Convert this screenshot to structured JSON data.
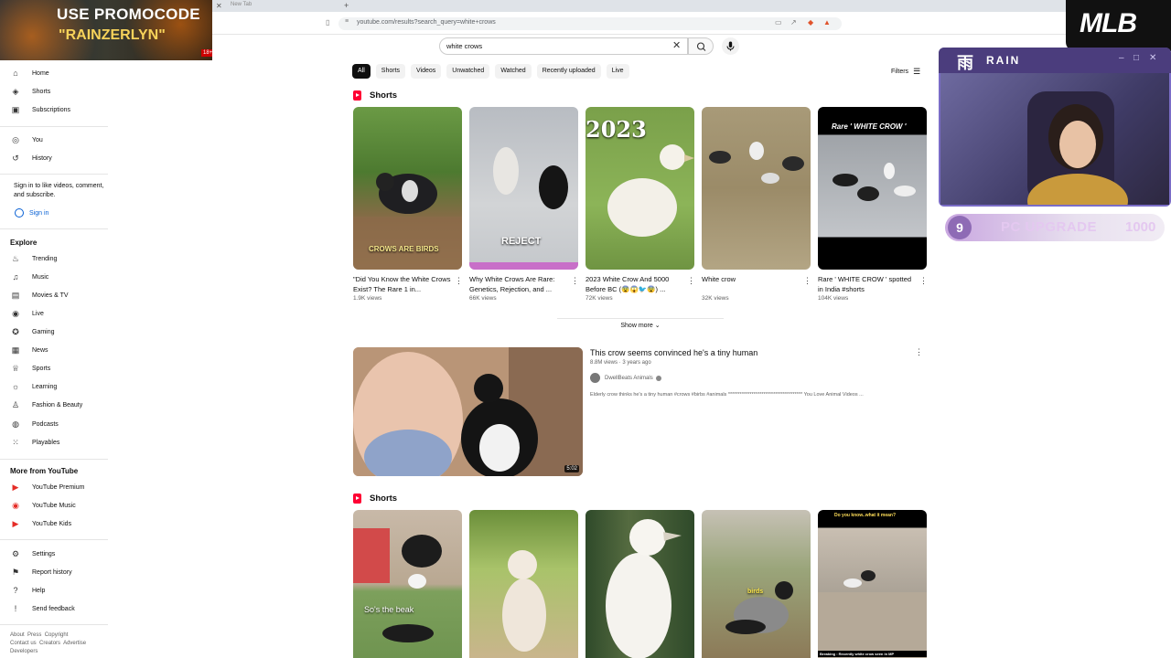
{
  "browser": {
    "tab_label": "New Tab",
    "url": "youtube.com/results?search_query=white+crows"
  },
  "promo": {
    "line1": "USE PROMOCODE",
    "line2": "\"RAINZERLYN\"",
    "age_badge": "18+"
  },
  "search": {
    "value": "white crows"
  },
  "sidebar": {
    "main": [
      {
        "label": "Home",
        "icon": "home-icon"
      },
      {
        "label": "Shorts",
        "icon": "shorts-icon"
      },
      {
        "label": "Subscriptions",
        "icon": "subscriptions-icon"
      }
    ],
    "you": [
      {
        "label": "You",
        "icon": "you-icon"
      },
      {
        "label": "History",
        "icon": "history-icon"
      }
    ],
    "signin_note": "Sign in to like videos, comment, and subscribe.",
    "signin_label": "Sign in",
    "explore_heading": "Explore",
    "explore": [
      {
        "label": "Trending",
        "icon": "trending-icon"
      },
      {
        "label": "Music",
        "icon": "music-icon"
      },
      {
        "label": "Movies & TV",
        "icon": "movies-icon"
      },
      {
        "label": "Live",
        "icon": "live-icon"
      },
      {
        "label": "Gaming",
        "icon": "gaming-icon"
      },
      {
        "label": "News",
        "icon": "news-icon"
      },
      {
        "label": "Sports",
        "icon": "sports-icon"
      },
      {
        "label": "Learning",
        "icon": "learning-icon"
      },
      {
        "label": "Fashion & Beauty",
        "icon": "fashion-icon"
      },
      {
        "label": "Podcasts",
        "icon": "podcasts-icon"
      },
      {
        "label": "Playables",
        "icon": "playables-icon"
      }
    ],
    "more_heading": "More from YouTube",
    "more": [
      {
        "label": "YouTube Premium",
        "icon": "youtube-premium-icon"
      },
      {
        "label": "YouTube Music",
        "icon": "youtube-music-icon"
      },
      {
        "label": "YouTube Kids",
        "icon": "youtube-kids-icon"
      }
    ],
    "settings": [
      {
        "label": "Settings",
        "icon": "settings-icon"
      },
      {
        "label": "Report history",
        "icon": "flag-icon"
      },
      {
        "label": "Help",
        "icon": "help-icon"
      },
      {
        "label": "Send feedback",
        "icon": "feedback-icon"
      }
    ],
    "footer_links": [
      "About",
      "Press",
      "Copyright",
      "Contact us",
      "Creators",
      "Advertise",
      "Developers"
    ]
  },
  "chips": [
    "All",
    "Shorts",
    "Videos",
    "Unwatched",
    "Watched",
    "Recently uploaded",
    "Live"
  ],
  "filters_label": "Filters",
  "shorts_section_1": {
    "title": "Shorts",
    "items": [
      {
        "title": "\"Did You Know the White Crows Exist? The Rare 1 in...",
        "views": "1.9K views",
        "overlay": "CROWS ARE BIRDS"
      },
      {
        "title": "Why White Crows Are Rare: Genetics, Rejection, and ...",
        "views": "66K views",
        "overlay": "REJECT"
      },
      {
        "title": "2023 White Crow And 5000 Before BC (😨😱🐦😨) ...",
        "views": "72K views",
        "overlay": "2023"
      },
      {
        "title": "White crow",
        "views": "32K views",
        "overlay": ""
      },
      {
        "title": "Rare ' WHITE CROW ' spotted in India #shorts",
        "views": "104K views",
        "overlay": "Rare ' WHITE CROW '"
      }
    ]
  },
  "show_more": "Show more",
  "video": {
    "title": "This crow seems convinced he's a tiny human",
    "meta": "8.8M views · 3 years ago",
    "channel": "DwellBeats Animals",
    "description": "Elderly crow thinks he's a tiny human #crows #birbs #animals ************************************** You Love Animal Videos ...",
    "duration": "5:02"
  },
  "shorts_section_2": {
    "title": "Shorts",
    "items": [
      {
        "overlay": "So's the beak"
      },
      {
        "overlay": ""
      },
      {
        "overlay": ""
      },
      {
        "overlay": "birds"
      },
      {
        "overlay": "Do you know..what it mean?",
        "bottom": "Breaking : Recently white crow seen in MP"
      }
    ]
  },
  "stream": {
    "mlb_logo": "MLB",
    "rain_logo": "雨",
    "rain_name": "RAIN",
    "goal_current": "9",
    "goal_label": "PC UPGRADE",
    "goal_target": "1000"
  }
}
